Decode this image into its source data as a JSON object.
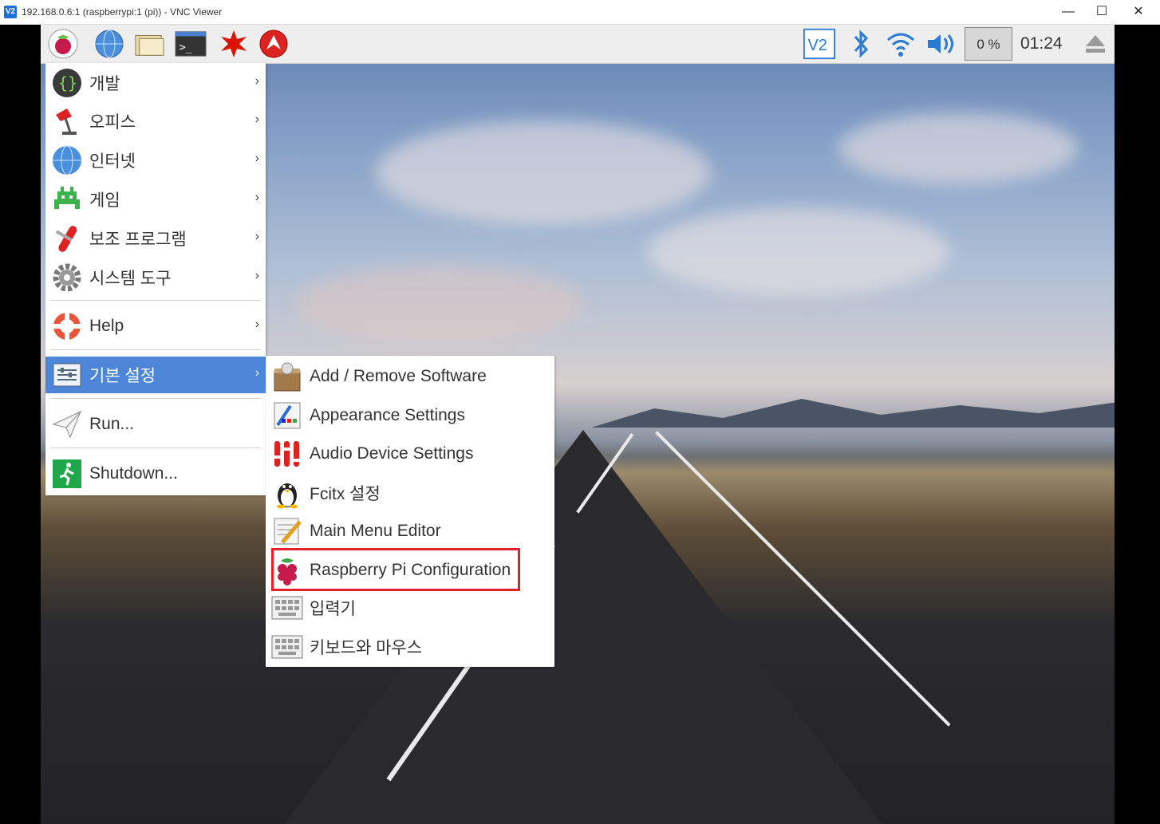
{
  "window": {
    "title": "192.168.0.6:1 (raspberrypi:1 (pi)) - VNC Viewer",
    "app_icon_text": "V2",
    "minimize": "—",
    "maximize": "☐",
    "close": "✕"
  },
  "panel": {
    "launchers": [
      "raspberry-menu-icon",
      "web-browser-icon",
      "file-manager-icon",
      "terminal-icon",
      "wolfram-icon",
      "mathematica-icon"
    ],
    "tray": [
      "vnc-icon",
      "bluetooth-icon",
      "wifi-icon",
      "volume-icon"
    ],
    "cpu_usage": "0 %",
    "clock": "01:24",
    "eject_icon": "eject-icon"
  },
  "main_menu": {
    "items": [
      {
        "label": "개발",
        "icon": "programming-icon"
      },
      {
        "label": "오피스",
        "icon": "office-icon"
      },
      {
        "label": "인터넷",
        "icon": "internet-icon"
      },
      {
        "label": "게임",
        "icon": "games-icon"
      },
      {
        "label": "보조 프로그램",
        "icon": "accessories-icon"
      },
      {
        "label": "시스템 도구",
        "icon": "system-tools-icon"
      },
      {
        "label": "Help",
        "icon": "help-icon"
      },
      {
        "label": "기본 설정",
        "icon": "preferences-icon"
      },
      {
        "label": "Run...",
        "icon": "run-icon"
      },
      {
        "label": "Shutdown...",
        "icon": "shutdown-icon"
      }
    ],
    "arrow": "›",
    "active_index": 7
  },
  "sub_menu": {
    "items": [
      {
        "label": "Add / Remove Software",
        "icon": "software-icon"
      },
      {
        "label": "Appearance Settings",
        "icon": "appearance-icon"
      },
      {
        "label": "Audio Device Settings",
        "icon": "audio-mixer-icon"
      },
      {
        "label": "Fcitx 설정",
        "icon": "penguin-icon"
      },
      {
        "label": "Main Menu Editor",
        "icon": "menu-editor-icon"
      },
      {
        "label": "Raspberry Pi Configuration",
        "icon": "raspberry-icon"
      },
      {
        "label": "입력기",
        "icon": "keyboard-icon"
      },
      {
        "label": "키보드와 마우스",
        "icon": "keyboard-icon"
      }
    ],
    "highlighted_index": 5
  },
  "colors": {
    "menu_active": "#4d86d9",
    "highlight_box": "#e5202b"
  }
}
